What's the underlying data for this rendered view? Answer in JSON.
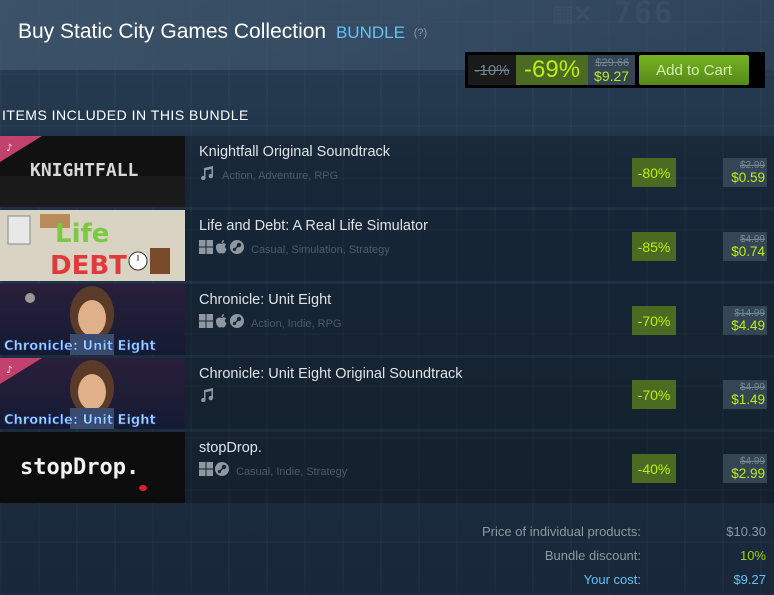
{
  "page": {
    "title": "Buy Static City Games Collection",
    "badge": "BUNDLE",
    "help": "(?)"
  },
  "purchase": {
    "bundle_discount": "-10%",
    "discount": "-69%",
    "original_price": "$29.66",
    "final_price": "$9.27",
    "add_to_cart": "Add to Cart"
  },
  "section_title": "ITEMS INCLUDED IN THIS BUNDLE",
  "items": [
    {
      "name": "Knightfall Original Soundtrack",
      "tags": "Action, Adventure, RPG",
      "platforms": [
        "music-icon"
      ],
      "discount": "-80%",
      "original": "$2.99",
      "final": "$0.59",
      "capsule_text": "KNIGHTFALL",
      "dlc": true
    },
    {
      "name": "Life and Debt: A Real Life Simulator",
      "tags": "Casual, Simulation, Strategy",
      "platforms": [
        "windows-icon",
        "apple-icon",
        "steam-icon"
      ],
      "discount": "-85%",
      "original": "$4.99",
      "final": "$0.74",
      "capsule_text": "Life and DEBT",
      "dlc": false
    },
    {
      "name": "Chronicle: Unit Eight",
      "tags": "Action, Indie, RPG",
      "platforms": [
        "windows-icon",
        "apple-icon",
        "steam-icon"
      ],
      "discount": "-70%",
      "original": "$14.99",
      "final": "$4.49",
      "capsule_text": "Chronicle: Unit Eight",
      "dlc": false
    },
    {
      "name": "Chronicle: Unit Eight Original Soundtrack",
      "tags": "",
      "platforms": [
        "music-icon"
      ],
      "discount": "-70%",
      "original": "$4.99",
      "final": "$1.49",
      "capsule_text": "Chronicle: Unit Eight",
      "dlc": true
    },
    {
      "name": "stopDrop.",
      "tags": "Casual, Indie, Strategy",
      "platforms": [
        "windows-icon",
        "steam-icon"
      ],
      "discount": "-40%",
      "original": "$4.99",
      "final": "$2.99",
      "capsule_text": "stopDrop.",
      "dlc": false
    }
  ],
  "totals": {
    "individual_label": "Price of individual products:",
    "individual_value": "$10.30",
    "discount_label": "Bundle discount:",
    "discount_value": "10%",
    "cost_label": "Your cost:",
    "cost_value": "$9.27"
  },
  "colors": {
    "discount_bg": "#4c6b22",
    "discount_text": "#beee11",
    "accent_blue": "#67c1f5",
    "page_bg": "#1b2838"
  }
}
